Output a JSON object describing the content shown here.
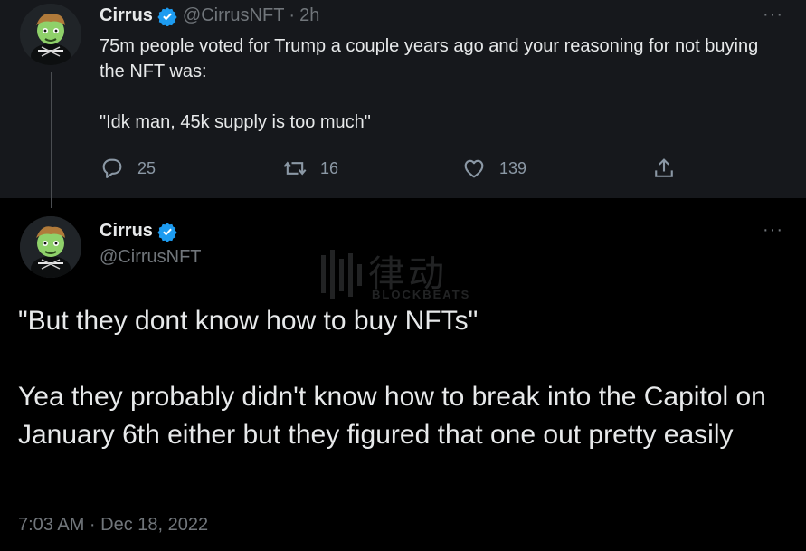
{
  "tweet1": {
    "name": "Cirrus",
    "handle": "@CirrusNFT",
    "separator": "·",
    "time": "2h",
    "more": "···",
    "text_line1": "75m people voted for Trump a couple years ago and your reasoning for not buying the NFT was:",
    "text_line2": "\"Idk man, 45k supply is too much\"",
    "actions": {
      "replies": "25",
      "retweets": "16",
      "likes": "139"
    }
  },
  "tweet2": {
    "name": "Cirrus",
    "handle": "@CirrusNFT",
    "more": "···",
    "text_line1": "\"But they dont know how to buy NFTs\"",
    "text_line2": "Yea they probably didn't know how to break into the Capitol on January 6th either but they figured that one out pretty easily",
    "timestamp": "7:03 AM · Dec 18, 2022"
  },
  "watermark": {
    "cn": "律动",
    "en": "BLOCKBEATS"
  },
  "colors": {
    "background": "#000000",
    "tweet1_background": "#16181c",
    "text": "#e7e9ea",
    "secondary": "#71767b",
    "verified": "#1d9bf0"
  },
  "icons": [
    "verified-badge-icon",
    "reply-icon",
    "retweet-icon",
    "like-icon",
    "share-icon",
    "more-icon"
  ]
}
